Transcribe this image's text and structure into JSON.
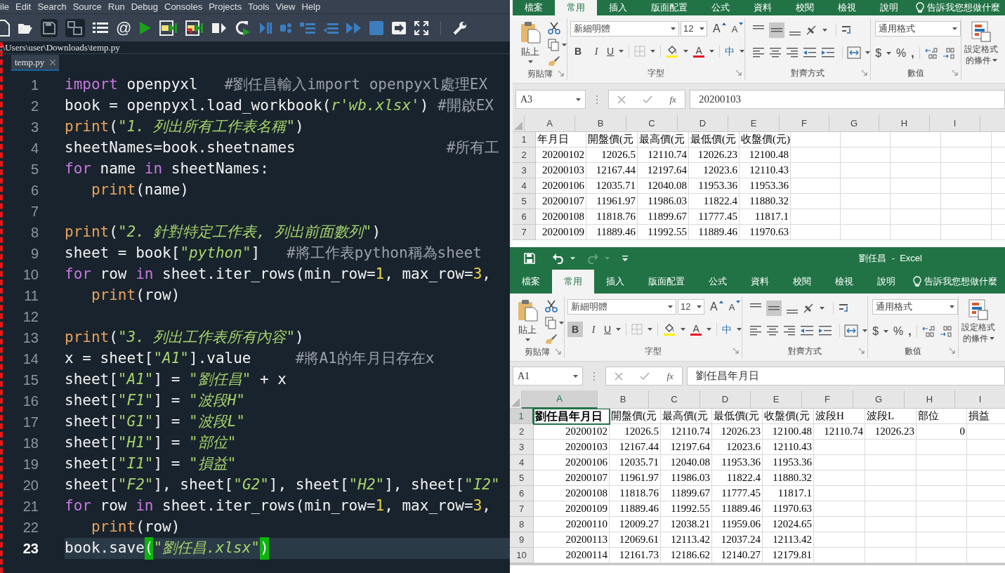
{
  "editor": {
    "menu": [
      "ile",
      "Edit",
      "Search",
      "Source",
      "Run",
      "Debug",
      "Consoles",
      "Projects",
      "Tools",
      "View",
      "Help"
    ],
    "toolbar": {
      "at_button": "@"
    },
    "path": ":\\Users\\user\\Downloads\\temp.py",
    "tabs": [
      {
        "label": "temp.py",
        "selected": true
      }
    ],
    "lines": [
      {
        "number": "1",
        "current": false,
        "tokens": [
          {
            "kind": "keyword",
            "text": "import"
          },
          {
            "kind": "plain",
            "text": " openpyxl   "
          },
          {
            "kind": "comment",
            "text": "#劉任昌輸入import openpyxl處理EX"
          }
        ]
      },
      {
        "number": "2",
        "current": false,
        "tokens": [
          {
            "kind": "plain",
            "text": "book = openpyxl.load_workbook("
          },
          {
            "kind": "string",
            "text": "r'wb.xlsx'"
          },
          {
            "kind": "plain",
            "text": ") "
          },
          {
            "kind": "comment",
            "text": "#開啟EX"
          }
        ]
      },
      {
        "number": "3",
        "current": false,
        "tokens": [
          {
            "kind": "builtin",
            "text": "print"
          },
          {
            "kind": "plain",
            "text": "("
          },
          {
            "kind": "string",
            "text": "\"1. 列出所有工作表名稱\""
          },
          {
            "kind": "plain",
            "text": ")"
          }
        ]
      },
      {
        "number": "4",
        "current": false,
        "tokens": [
          {
            "kind": "plain",
            "text": "sheetNames=book.sheetnames                 "
          },
          {
            "kind": "comment",
            "text": "#所有工"
          }
        ]
      },
      {
        "number": "5",
        "current": false,
        "tokens": [
          {
            "kind": "keyword",
            "text": "for"
          },
          {
            "kind": "plain",
            "text": " name "
          },
          {
            "kind": "keyword",
            "text": "in"
          },
          {
            "kind": "plain",
            "text": " sheetNames:"
          }
        ]
      },
      {
        "number": "6",
        "current": false,
        "tokens": [
          {
            "kind": "builtin",
            "text": "   print"
          },
          {
            "kind": "plain",
            "text": "(name)"
          }
        ]
      },
      {
        "number": "7",
        "current": false
      },
      {
        "number": "8",
        "current": false,
        "tokens": [
          {
            "kind": "builtin",
            "text": "print"
          },
          {
            "kind": "plain",
            "text": "("
          },
          {
            "kind": "string",
            "text": "\"2. 針對特定工作表, 列出前面數列\""
          },
          {
            "kind": "plain",
            "text": ")"
          }
        ]
      },
      {
        "number": "9",
        "current": false,
        "tokens": [
          {
            "kind": "plain",
            "text": "sheet = book["
          },
          {
            "kind": "string",
            "text": "\"python\""
          },
          {
            "kind": "plain",
            "text": "]   "
          },
          {
            "kind": "comment",
            "text": "#將工作表python稱為sheet"
          }
        ]
      },
      {
        "number": "10",
        "current": false,
        "tokens": [
          {
            "kind": "keyword",
            "text": "for"
          },
          {
            "kind": "plain",
            "text": " row "
          },
          {
            "kind": "keyword",
            "text": "in"
          },
          {
            "kind": "plain",
            "text": " sheet.iter_rows(min_row="
          },
          {
            "kind": "number",
            "text": "1"
          },
          {
            "kind": "plain",
            "text": ", max_row="
          },
          {
            "kind": "number",
            "text": "3"
          },
          {
            "kind": "plain",
            "text": ","
          }
        ]
      },
      {
        "number": "11",
        "current": false,
        "tokens": [
          {
            "kind": "builtin",
            "text": "   print"
          },
          {
            "kind": "plain",
            "text": "(row)"
          }
        ]
      },
      {
        "number": "12",
        "current": false
      },
      {
        "number": "13",
        "current": false,
        "tokens": [
          {
            "kind": "builtin",
            "text": "print"
          },
          {
            "kind": "plain",
            "text": "("
          },
          {
            "kind": "string",
            "text": "\"3. 列出工作表所有內容\""
          },
          {
            "kind": "plain",
            "text": ")"
          }
        ]
      },
      {
        "number": "14",
        "current": false,
        "tokens": [
          {
            "kind": "plain",
            "text": "x = sheet["
          },
          {
            "kind": "string",
            "text": "\"A1\""
          },
          {
            "kind": "plain",
            "text": "].value     "
          },
          {
            "kind": "comment",
            "text": "#將A1的年月日存在x"
          }
        ]
      },
      {
        "number": "15",
        "current": false,
        "tokens": [
          {
            "kind": "plain",
            "text": "sheet["
          },
          {
            "kind": "string",
            "text": "\"A1\""
          },
          {
            "kind": "plain",
            "text": "] = "
          },
          {
            "kind": "string",
            "text": "\"劉任昌\""
          },
          {
            "kind": "plain",
            "text": " + x"
          }
        ]
      },
      {
        "number": "16",
        "current": false,
        "tokens": [
          {
            "kind": "plain",
            "text": "sheet["
          },
          {
            "kind": "string",
            "text": "\"F1\""
          },
          {
            "kind": "plain",
            "text": "] = "
          },
          {
            "kind": "string",
            "text": "\"波段H\""
          }
        ]
      },
      {
        "number": "17",
        "current": false,
        "tokens": [
          {
            "kind": "plain",
            "text": "sheet["
          },
          {
            "kind": "string",
            "text": "\"G1\""
          },
          {
            "kind": "plain",
            "text": "] = "
          },
          {
            "kind": "string",
            "text": "\"波段L\""
          }
        ]
      },
      {
        "number": "18",
        "current": false,
        "tokens": [
          {
            "kind": "plain",
            "text": "sheet["
          },
          {
            "kind": "string",
            "text": "\"H1\""
          },
          {
            "kind": "plain",
            "text": "] = "
          },
          {
            "kind": "string",
            "text": "\"部位\""
          }
        ]
      },
      {
        "number": "19",
        "current": false,
        "tokens": [
          {
            "kind": "plain",
            "text": "sheet["
          },
          {
            "kind": "string",
            "text": "\"I1\""
          },
          {
            "kind": "plain",
            "text": "] = "
          },
          {
            "kind": "string",
            "text": "\"損益\""
          }
        ]
      },
      {
        "number": "20",
        "current": false,
        "tokens": [
          {
            "kind": "plain",
            "text": "sheet["
          },
          {
            "kind": "string",
            "text": "\"F2\""
          },
          {
            "kind": "plain",
            "text": "], sheet["
          },
          {
            "kind": "string",
            "text": "\"G2\""
          },
          {
            "kind": "plain",
            "text": "], sheet["
          },
          {
            "kind": "string",
            "text": "\"H2\""
          },
          {
            "kind": "plain",
            "text": "], sheet["
          },
          {
            "kind": "string",
            "text": "\"I2\""
          }
        ]
      },
      {
        "number": "21",
        "current": false,
        "tokens": [
          {
            "kind": "keyword",
            "text": "for"
          },
          {
            "kind": "plain",
            "text": " row "
          },
          {
            "kind": "keyword",
            "text": "in"
          },
          {
            "kind": "plain",
            "text": " sheet.iter_rows(min_row="
          },
          {
            "kind": "number",
            "text": "1"
          },
          {
            "kind": "plain",
            "text": ", max_row="
          },
          {
            "kind": "number",
            "text": "3"
          },
          {
            "kind": "plain",
            "text": ","
          }
        ]
      },
      {
        "number": "22",
        "current": false,
        "tokens": [
          {
            "kind": "builtin",
            "text": "   print"
          },
          {
            "kind": "plain",
            "text": "(row)"
          }
        ]
      },
      {
        "number": "23",
        "current": true,
        "tokens": [
          {
            "kind": "plain",
            "text": "book.save"
          },
          {
            "kind": "bracket_match",
            "text": "("
          },
          {
            "kind": "string",
            "text": "\"劉任昌.xlsx\""
          },
          {
            "kind": "bracket_match",
            "text": ")"
          }
        ]
      }
    ]
  },
  "excel_windows": [
    {
      "tabs": [
        {
          "label": "檔案",
          "selected": false
        },
        {
          "label": "常用",
          "selected": true
        },
        {
          "label": "插入",
          "selected": false
        },
        {
          "label": "版面配置",
          "selected": false
        },
        {
          "label": "公式",
          "selected": false
        },
        {
          "label": "資料",
          "selected": false
        },
        {
          "label": "校閱",
          "selected": false
        },
        {
          "label": "檢視",
          "selected": false
        },
        {
          "label": "說明",
          "selected": false
        }
      ],
      "tell_me": "告訴我您想做什麼",
      "ribbon": {
        "paste": "貼上",
        "clipboard_group": "剪貼簿",
        "font_name": "新細明體",
        "font_size": "12",
        "grow_font": "A",
        "shrink_font": "A",
        "bold_button": "B",
        "bold": false,
        "italic_button": "I",
        "underline_button": "U",
        "font_color": "A",
        "phonetic": "中",
        "font_group": "字型",
        "middle_aligned": true,
        "alignment_group": "對齊方式",
        "number_format": "通用格式",
        "currency": "$",
        "percent": "%",
        "comma": ",",
        "number_group": "數值",
        "styles_line1": "設定格式",
        "styles_line2": "的條件"
      },
      "name_box": "A3",
      "insert_function": "fx",
      "formula": "20200103",
      "columns": [
        {
          "label": "A",
          "selected": false
        },
        {
          "label": "B",
          "selected": false
        },
        {
          "label": "C",
          "selected": false
        },
        {
          "label": "D",
          "selected": false
        },
        {
          "label": "E",
          "selected": false
        },
        {
          "label": "F",
          "selected": false
        },
        {
          "label": "G",
          "selected": false
        },
        {
          "label": "H",
          "selected": false
        },
        {
          "label": "I",
          "selected": false
        }
      ],
      "rows": [
        {
          "header": "1",
          "selected": false,
          "kind": "header",
          "cells": [
            {
              "text": "年月日",
              "bold": false
            },
            {
              "text": "開盤價(元",
              "bold": false
            },
            {
              "text": "最高價(元",
              "bold": false
            },
            {
              "text": "最低價(元",
              "bold": false
            },
            {
              "text": "收盤價(元)",
              "bold": false
            }
          ]
        },
        {
          "header": "2",
          "selected": false,
          "kind": "data",
          "cells": [
            {
              "text": "20200102",
              "bold": false
            },
            {
              "text": "12026.5",
              "bold": false
            },
            {
              "text": "12110.74",
              "bold": false
            },
            {
              "text": "12026.23",
              "bold": false
            },
            {
              "text": "12100.48",
              "bold": false
            }
          ]
        },
        {
          "header": "3",
          "selected": false,
          "kind": "data",
          "cells": [
            {
              "text": "20200103",
              "bold": false
            },
            {
              "text": "12167.44",
              "bold": false
            },
            {
              "text": "12197.64",
              "bold": false
            },
            {
              "text": "12023.6",
              "bold": false
            },
            {
              "text": "12110.43",
              "bold": false
            }
          ]
        },
        {
          "header": "4",
          "selected": false,
          "kind": "data",
          "cells": [
            {
              "text": "20200106",
              "bold": false
            },
            {
              "text": "12035.71",
              "bold": false
            },
            {
              "text": "12040.08",
              "bold": false
            },
            {
              "text": "11953.36",
              "bold": false
            },
            {
              "text": "11953.36",
              "bold": false
            }
          ]
        },
        {
          "header": "5",
          "selected": false,
          "kind": "data",
          "cells": [
            {
              "text": "20200107",
              "bold": false
            },
            {
              "text": "11961.97",
              "bold": false
            },
            {
              "text": "11986.03",
              "bold": false
            },
            {
              "text": "11822.4",
              "bold": false
            },
            {
              "text": "11880.32",
              "bold": false
            }
          ]
        },
        {
          "header": "6",
          "selected": false,
          "kind": "data",
          "cells": [
            {
              "text": "20200108",
              "bold": false
            },
            {
              "text": "11818.76",
              "bold": false
            },
            {
              "text": "11899.67",
              "bold": false
            },
            {
              "text": "11777.45",
              "bold": false
            },
            {
              "text": "11817.1",
              "bold": false
            }
          ]
        },
        {
          "header": "7",
          "selected": false,
          "kind": "data",
          "cells": [
            {
              "text": "20200109",
              "bold": false
            },
            {
              "text": "11889.46",
              "bold": false
            },
            {
              "text": "11992.55",
              "bold": false
            },
            {
              "text": "11889.46",
              "bold": false
            },
            {
              "text": "11970.63",
              "bold": false
            }
          ]
        }
      ]
    },
    {
      "quick_access": {
        "redo_enabled": false
      },
      "title": "劉任昌  -  Excel",
      "tabs": [
        {
          "label": "檔案",
          "selected": false
        },
        {
          "label": "常用",
          "selected": true
        },
        {
          "label": "插入",
          "selected": false
        },
        {
          "label": "版面配置",
          "selected": false
        },
        {
          "label": "公式",
          "selected": false
        },
        {
          "label": "資料",
          "selected": false
        },
        {
          "label": "校閱",
          "selected": false
        },
        {
          "label": "檢視",
          "selected": false
        },
        {
          "label": "說明",
          "selected": false
        }
      ],
      "tell_me": "告訴我您想做什麼",
      "ribbon": {
        "paste": "貼上",
        "clipboard_group": "剪貼簿",
        "font_name": "新細明體",
        "font_size": "12",
        "grow_font": "A",
        "shrink_font": "A",
        "bold_button": "B",
        "bold": true,
        "italic_button": "I",
        "underline_button": "U",
        "font_color": "A",
        "phonetic": "中",
        "font_group": "字型",
        "middle_aligned": true,
        "alignment_group": "對齊方式",
        "number_format": "通用格式",
        "currency": "$",
        "percent": "%",
        "comma": ",",
        "number_group": "數值",
        "styles_line1": "設定格式",
        "styles_line2": "的條件"
      },
      "name_box": "A1",
      "insert_function": "fx",
      "formula": "劉任昌年月日",
      "columns": [
        {
          "label": "A",
          "selected": true
        },
        {
          "label": "B",
          "selected": false
        },
        {
          "label": "C",
          "selected": false
        },
        {
          "label": "D",
          "selected": false
        },
        {
          "label": "E",
          "selected": false
        },
        {
          "label": "F",
          "selected": false
        },
        {
          "label": "G",
          "selected": false
        },
        {
          "label": "H",
          "selected": false
        },
        {
          "label": "I",
          "selected": false
        }
      ],
      "rows": [
        {
          "header": "1",
          "selected": true,
          "kind": "header",
          "cells": [
            {
              "text": "劉任昌年月日",
              "bold": true
            },
            {
              "text": "開盤價(元",
              "bold": false
            },
            {
              "text": "最高價(元",
              "bold": false
            },
            {
              "text": "最低價(元",
              "bold": false
            },
            {
              "text": "收盤價(元",
              "bold": false
            },
            {
              "text": "波段H",
              "bold": false
            },
            {
              "text": "波段L",
              "bold": false
            },
            {
              "text": "部位",
              "bold": false
            },
            {
              "text": "損益",
              "bold": false
            }
          ]
        },
        {
          "header": "2",
          "selected": false,
          "kind": "data",
          "cells": [
            {
              "text": "20200102",
              "bold": false
            },
            {
              "text": "12026.5",
              "bold": false
            },
            {
              "text": "12110.74",
              "bold": false
            },
            {
              "text": "12026.23",
              "bold": false
            },
            {
              "text": "12100.48",
              "bold": false
            },
            {
              "text": "12110.74",
              "bold": false
            },
            {
              "text": "12026.23",
              "bold": false
            },
            {
              "text": "0",
              "bold": false
            }
          ]
        },
        {
          "header": "3",
          "selected": false,
          "kind": "data",
          "cells": [
            {
              "text": "20200103",
              "bold": false
            },
            {
              "text": "12167.44",
              "bold": false
            },
            {
              "text": "12197.64",
              "bold": false
            },
            {
              "text": "12023.6",
              "bold": false
            },
            {
              "text": "12110.43",
              "bold": false
            }
          ]
        },
        {
          "header": "4",
          "selected": false,
          "kind": "data",
          "cells": [
            {
              "text": "20200106",
              "bold": false
            },
            {
              "text": "12035.71",
              "bold": false
            },
            {
              "text": "12040.08",
              "bold": false
            },
            {
              "text": "11953.36",
              "bold": false
            },
            {
              "text": "11953.36",
              "bold": false
            }
          ]
        },
        {
          "header": "5",
          "selected": false,
          "kind": "data",
          "cells": [
            {
              "text": "20200107",
              "bold": false
            },
            {
              "text": "11961.97",
              "bold": false
            },
            {
              "text": "11986.03",
              "bold": false
            },
            {
              "text": "11822.4",
              "bold": false
            },
            {
              "text": "11880.32",
              "bold": false
            }
          ]
        },
        {
          "header": "6",
          "selected": false,
          "kind": "data",
          "cells": [
            {
              "text": "20200108",
              "bold": false
            },
            {
              "text": "11818.76",
              "bold": false
            },
            {
              "text": "11899.67",
              "bold": false
            },
            {
              "text": "11777.45",
              "bold": false
            },
            {
              "text": "11817.1",
              "bold": false
            }
          ]
        },
        {
          "header": "7",
          "selected": false,
          "kind": "data",
          "cells": [
            {
              "text": "20200109",
              "bold": false
            },
            {
              "text": "11889.46",
              "bold": false
            },
            {
              "text": "11992.55",
              "bold": false
            },
            {
              "text": "11889.46",
              "bold": false
            },
            {
              "text": "11970.63",
              "bold": false
            }
          ]
        },
        {
          "header": "8",
          "selected": false,
          "kind": "data",
          "cells": [
            {
              "text": "20200110",
              "bold": false
            },
            {
              "text": "12009.27",
              "bold": false
            },
            {
              "text": "12038.21",
              "bold": false
            },
            {
              "text": "11959.06",
              "bold": false
            },
            {
              "text": "12024.65",
              "bold": false
            }
          ]
        },
        {
          "header": "9",
          "selected": false,
          "kind": "data",
          "cells": [
            {
              "text": "20200113",
              "bold": false
            },
            {
              "text": "12069.61",
              "bold": false
            },
            {
              "text": "12113.42",
              "bold": false
            },
            {
              "text": "12037.24",
              "bold": false
            },
            {
              "text": "12113.42",
              "bold": false
            }
          ]
        },
        {
          "header": "10",
          "selected": false,
          "kind": "data",
          "cells": [
            {
              "text": "20200114",
              "bold": false
            },
            {
              "text": "12161.73",
              "bold": false
            },
            {
              "text": "12186.62",
              "bold": false
            },
            {
              "text": "12140.27",
              "bold": false
            },
            {
              "text": "12179.81",
              "bold": false
            }
          ]
        }
      ]
    }
  ]
}
